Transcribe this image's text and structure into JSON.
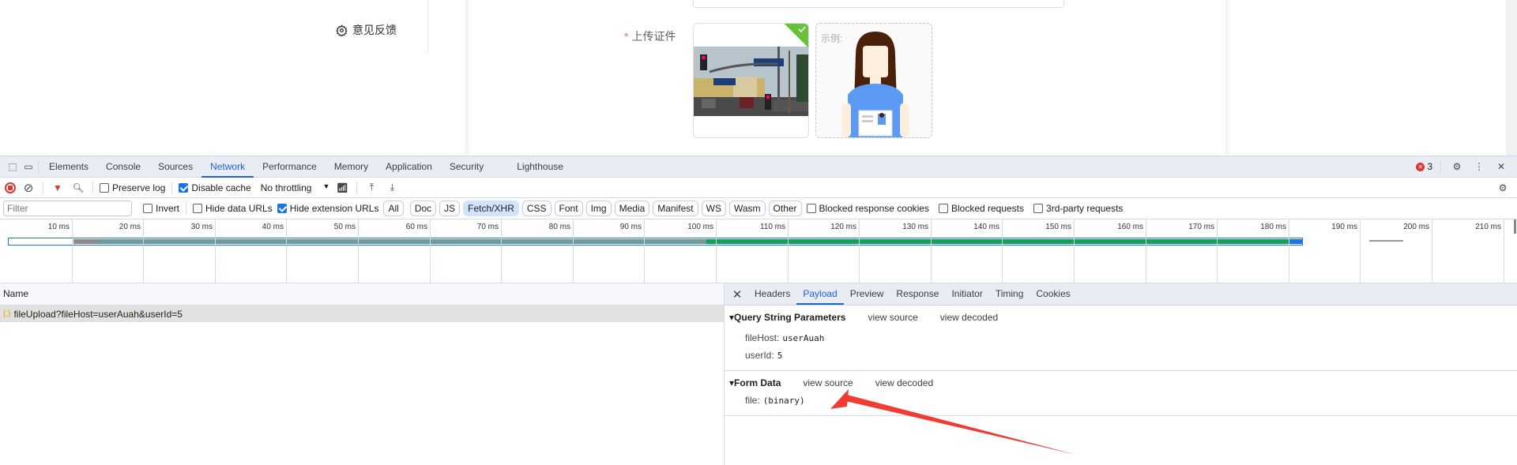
{
  "app": {
    "sidebar_item": "意见反馈",
    "upload_label": "上传证件",
    "required_mark": "*",
    "example_label": "示例:"
  },
  "devtools": {
    "tabs": [
      "Elements",
      "Console",
      "Sources",
      "Network",
      "Performance",
      "Memory",
      "Application",
      "Security",
      "Lighthouse"
    ],
    "active_tab": "Network",
    "error_count": "3",
    "toolbar": {
      "preserve_log": "Preserve log",
      "preserve_log_checked": false,
      "disable_cache": "Disable cache",
      "disable_cache_checked": true,
      "throttling": "No throttling"
    },
    "filter": {
      "placeholder": "Filter",
      "invert": "Invert",
      "hide_data_urls": "Hide data URLs",
      "hide_extension_urls": "Hide extension URLs",
      "hide_extension_urls_checked": true,
      "chips": [
        "All",
        "Doc",
        "JS",
        "Fetch/XHR",
        "CSS",
        "Font",
        "Img",
        "Media",
        "Manifest",
        "WS",
        "Wasm",
        "Other"
      ],
      "active_chip": "Fetch/XHR",
      "blocked_cookies": "Blocked response cookies",
      "blocked_requests": "Blocked requests",
      "third_party": "3rd-party requests"
    },
    "timeline_ticks": [
      "10 ms",
      "20 ms",
      "30 ms",
      "40 ms",
      "50 ms",
      "60 ms",
      "70 ms",
      "80 ms",
      "90 ms",
      "100 ms",
      "110 ms",
      "120 ms",
      "130 ms",
      "140 ms",
      "150 ms",
      "160 ms",
      "170 ms",
      "180 ms",
      "190 ms",
      "200 ms",
      "210 ms"
    ],
    "requests": {
      "header": "Name",
      "rows": [
        {
          "name": "fileUpload?fileHost=userAuah&userId=5"
        }
      ]
    },
    "detail": {
      "tabs": [
        "Headers",
        "Payload",
        "Preview",
        "Response",
        "Initiator",
        "Timing",
        "Cookies"
      ],
      "active_tab": "Payload",
      "query": {
        "title": "Query String Parameters",
        "view_source": "view source",
        "view_decoded": "view decoded",
        "params": [
          {
            "key": "fileHost:",
            "value": "userAuah"
          },
          {
            "key": "userId:",
            "value": "5"
          }
        ]
      },
      "form": {
        "title": "Form Data",
        "view_source": "view source",
        "view_decoded": "view decoded",
        "params": [
          {
            "key": "file:",
            "value": "(binary)"
          }
        ]
      }
    }
  },
  "colors": {
    "accent": "#1a64d6",
    "annotation_arrow": "#f03c32",
    "upload_success": "#67c23a"
  }
}
